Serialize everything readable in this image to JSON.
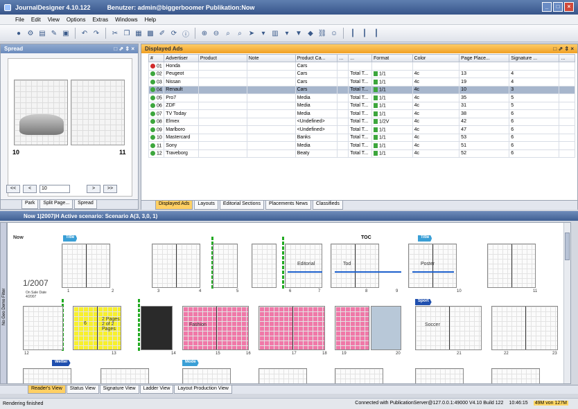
{
  "window": {
    "title": "JournalDesigner 4.10.122",
    "subtitle": "Benutzer: admin@biggerboomer Publikation:Now"
  },
  "menu": [
    "File",
    "Edit",
    "View",
    "Options",
    "Extras",
    "Windows",
    "Help"
  ],
  "spread_panel": {
    "title": "Spread",
    "left_page": "10",
    "right_page": "11",
    "page_input": "10",
    "nav": [
      "<<",
      "<",
      ">",
      ">>"
    ],
    "tabs": [
      "Park",
      "Split Page...",
      "Spread"
    ]
  },
  "ads_panel": {
    "title": "Displayed Ads",
    "columns": [
      "#",
      "Advertiser",
      "Product",
      "Note",
      "Product Ca...",
      "...",
      "...",
      "Format",
      "Color",
      "Page Place...",
      "Signature ...",
      "..."
    ],
    "rows": [
      {
        "n": "01",
        "advertiser": "Honda",
        "category": "Cars",
        "total": "",
        "format": "",
        "color": "",
        "page": "",
        "sig": "",
        "status": "red"
      },
      {
        "n": "02",
        "advertiser": "Peugeot",
        "category": "Cars",
        "total": "Total T...",
        "format": "1/1",
        "color": "4c",
        "page": "13",
        "sig": "4",
        "status": "green"
      },
      {
        "n": "03",
        "advertiser": "Nissan",
        "category": "Cars",
        "total": "Total T...",
        "format": "1/1",
        "color": "4c",
        "page": "19",
        "sig": "4",
        "status": "green"
      },
      {
        "n": "04",
        "advertiser": "Renault",
        "category": "Cars",
        "total": "Total T...",
        "format": "1/1",
        "color": "4c",
        "page": "10",
        "sig": "3",
        "status": "green"
      },
      {
        "n": "05",
        "advertiser": "Pro7",
        "category": "Media",
        "total": "Total T...",
        "format": "1/1",
        "color": "4c",
        "page": "35",
        "sig": "5",
        "status": "green"
      },
      {
        "n": "06",
        "advertiser": "ZDF",
        "category": "Media",
        "total": "Total T...",
        "format": "1/1",
        "color": "4c",
        "page": "31",
        "sig": "5",
        "status": "green"
      },
      {
        "n": "07",
        "advertiser": "TV Today",
        "category": "Media",
        "total": "Total T...",
        "format": "1/1",
        "color": "4c",
        "page": "38",
        "sig": "6",
        "status": "green"
      },
      {
        "n": "08",
        "advertiser": "Elmex",
        "category": "<Undefined>",
        "total": "Total T...",
        "format": "1/2V",
        "color": "4c",
        "page": "42",
        "sig": "6",
        "status": "green"
      },
      {
        "n": "09",
        "advertiser": "Marlboro",
        "category": "<Undefined>",
        "total": "Total T...",
        "format": "1/1",
        "color": "4c",
        "page": "47",
        "sig": "6",
        "status": "green"
      },
      {
        "n": "10",
        "advertiser": "Mastercard",
        "category": "Banks",
        "total": "Total T...",
        "format": "1/1",
        "color": "4c",
        "page": "53",
        "sig": "6",
        "status": "green"
      },
      {
        "n": "11",
        "advertiser": "Sony",
        "category": "Media",
        "total": "Total T...",
        "format": "1/1",
        "color": "4c",
        "page": "51",
        "sig": "6",
        "status": "green"
      },
      {
        "n": "12",
        "advertiser": "Traveborg",
        "category": "Beaty",
        "total": "Total T...",
        "format": "1/1",
        "color": "4c",
        "page": "52",
        "sig": "6",
        "status": "green"
      }
    ],
    "tabs": [
      "Displayed Ads",
      "Layouts",
      "Editorial Sections",
      "Placements News",
      "Classifieds"
    ]
  },
  "scenario": {
    "label": "Now 1|2007|H Active scenario: Scenario A(3, 3,0, 1)"
  },
  "ladder": {
    "issue": "1/2007",
    "issue_note": "On Sale Date 4/2007",
    "cover_label": "Now",
    "flags": [
      "Title",
      "Title",
      "Sport",
      "Wetter",
      "Mode"
    ],
    "toc": "TOC",
    "page_numbers": [
      "1",
      "2",
      "3",
      "4",
      "5",
      "6",
      "7",
      "8",
      "9",
      "10",
      "11",
      "12",
      "13",
      "14",
      "15",
      "16",
      "17",
      "18",
      "19",
      "20",
      "21",
      "22",
      "23"
    ],
    "foldout": "2 Pages 2 of 2 Pages",
    "foldout_left": "6",
    "labels": [
      "Editorial",
      "Editorial",
      "Tod",
      "Poster",
      "Fashion",
      "Soccer"
    ]
  },
  "bottom_tabs": [
    "Reader's View",
    "Status View",
    "Signature View",
    "Ladder View",
    "Layout Production View"
  ],
  "sidebar_label": "No Geo Demo Filter",
  "status": {
    "left": "Rendering finished",
    "connection": "Connected with PublicationServer@127.0.0.1:49000 V4.10 Build 122",
    "time": "10:46:15",
    "memory": "49M von 127M"
  }
}
